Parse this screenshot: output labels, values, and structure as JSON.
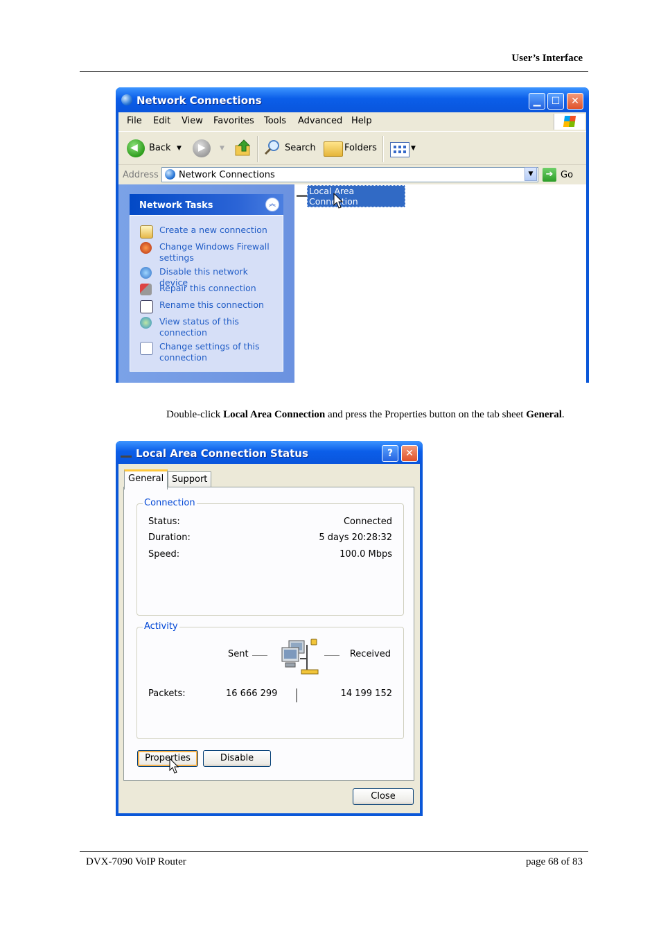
{
  "page": {
    "header_title": "User’s Interface",
    "footer_left": "DVX-7090 VoIP Router",
    "footer_right": "page 68 of 83",
    "instruction": {
      "p1": "Double-click ",
      "b1": "Local Area Connection",
      "p2": " and press the Properties button on the tab sheet ",
      "b2": "General",
      "p3": "."
    }
  },
  "network_window": {
    "title": "Network Connections",
    "menu": [
      "File",
      "Edit",
      "View",
      "Favorites",
      "Tools",
      "Advanced",
      "Help"
    ],
    "toolbar": {
      "back": "Back",
      "search": "Search",
      "folders": "Folders"
    },
    "address": {
      "label": "Address",
      "value": "Network Connections",
      "go": "Go"
    },
    "tasks": {
      "title": "Network Tasks",
      "items": [
        "Create a new connection",
        "Change Windows Firewall settings",
        "Disable this network device",
        "Repair this connection",
        "Rename this connection",
        "View status of this connection",
        "Change settings of this connection"
      ]
    },
    "selected_item": "Local Area Connection"
  },
  "status_dialog": {
    "title": "Local Area Connection Status",
    "tabs": [
      "General",
      "Support"
    ],
    "connection": {
      "legend": "Connection",
      "status_label": "Status:",
      "status_value": "Connected",
      "duration_label": "Duration:",
      "duration_value": "5 days 20:28:32",
      "speed_label": "Speed:",
      "speed_value": "100.0 Mbps"
    },
    "activity": {
      "legend": "Activity",
      "sent_label": "Sent",
      "received_label": "Received",
      "packets_label": "Packets:",
      "packets_sent": "16 666 299",
      "packets_received": "14 199 152"
    },
    "buttons": {
      "properties": "Properties",
      "disable": "Disable",
      "close": "Close"
    }
  },
  "colors": {
    "xp_blue": "#0a57d8",
    "link_blue": "#215dc6",
    "selection": "#316ac5"
  }
}
